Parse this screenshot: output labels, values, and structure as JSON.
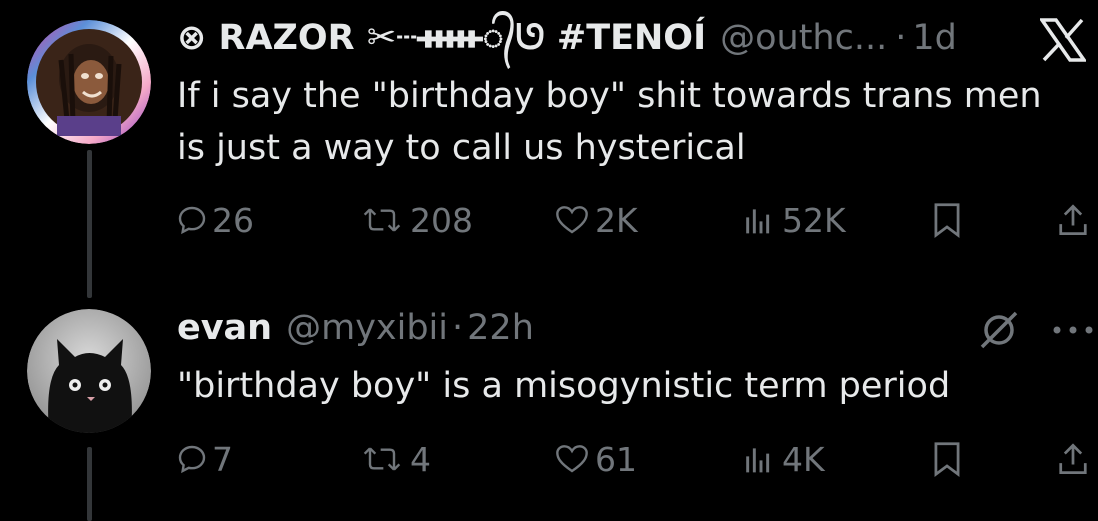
{
  "tweets": [
    {
      "display_name": "⊗ RAZOR ✂┄ᚔ᭄ᘎ #TENOÍ",
      "handle": "@outhc...",
      "separator": "·",
      "time": "1d",
      "text": "If i say the \"birthday boy\" shit towards trans men is just a way to call us hysterical",
      "stats": {
        "replies": "26",
        "retweets": "208",
        "likes": "2K",
        "views": "52K"
      }
    },
    {
      "display_name": "evan",
      "handle": "@myxibii",
      "separator": "·",
      "time": "22h",
      "text": "\"birthday boy\" is a misogynistic term period",
      "stats": {
        "replies": "7",
        "retweets": "4",
        "likes": "61",
        "views": "4K"
      }
    }
  ],
  "icons": {
    "brand": "x-logo-icon",
    "reply": "reply-bubble-icon",
    "retweet": "retweet-icon",
    "like": "heart-icon",
    "views": "views-bar-chart-icon",
    "bookmark": "bookmark-icon",
    "share": "share-icon",
    "grok": "grok-icon",
    "more": "more-dots-icon"
  },
  "colors": {
    "background": "#000000",
    "text": "#e7e9ea",
    "muted": "#71767b",
    "thread_line": "#333639"
  }
}
